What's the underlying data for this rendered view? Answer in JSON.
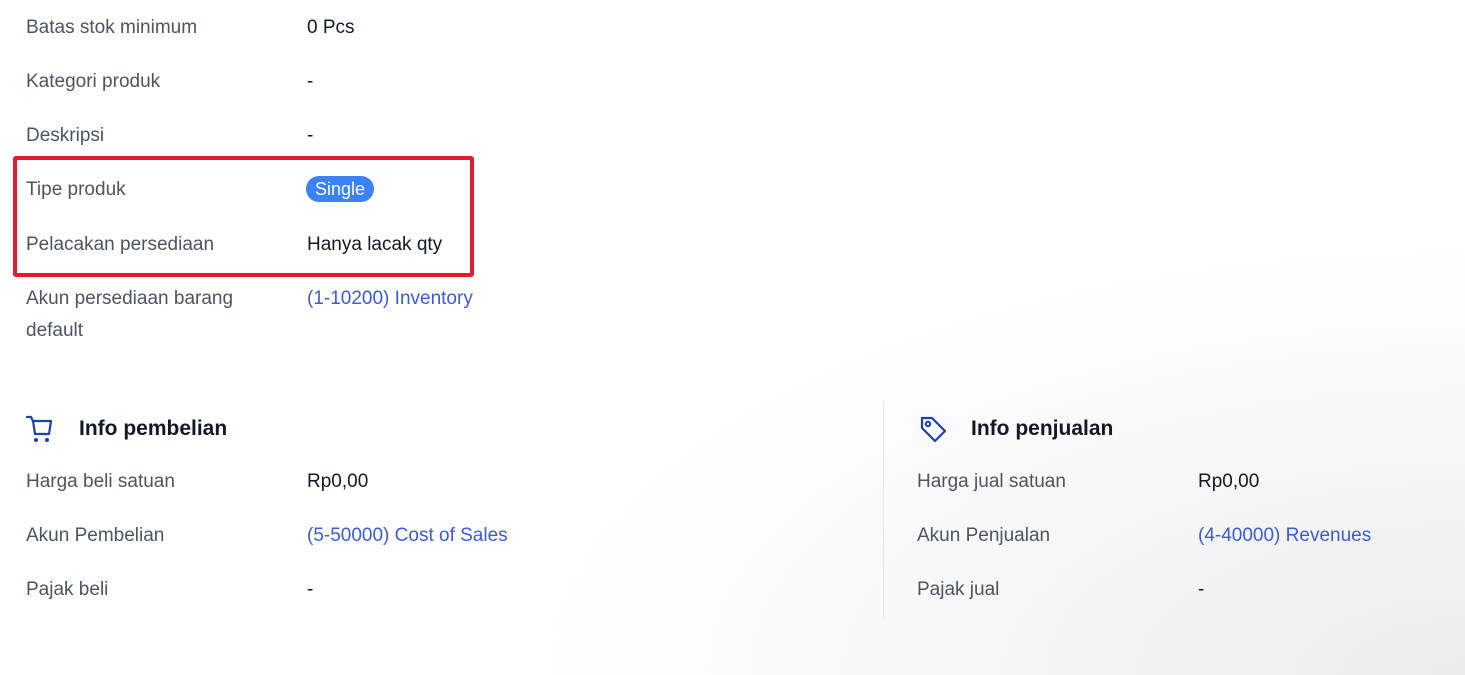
{
  "details": {
    "min_stock": {
      "label": "Batas stok minimum",
      "value": "0 Pcs"
    },
    "category": {
      "label": "Kategori produk",
      "value": "-"
    },
    "description": {
      "label": "Deskripsi",
      "value": "-"
    },
    "product_type": {
      "label": "Tipe produk",
      "value": "Single"
    },
    "inventory_tracking": {
      "label": "Pelacakan persediaan",
      "value": "Hanya lacak qty"
    },
    "default_inventory_account": {
      "label_line1": "Akun persediaan barang",
      "label_line2": "default",
      "value": "(1-10200) Inventory"
    }
  },
  "purchase": {
    "title": "Info pembelian",
    "icon": "shopping-cart-icon",
    "unit_price": {
      "label": "Harga beli satuan",
      "value": "Rp0,00"
    },
    "account": {
      "label": "Akun Pembelian",
      "value": "(5-50000) Cost of Sales"
    },
    "tax": {
      "label": "Pajak beli",
      "value": "-"
    }
  },
  "sales": {
    "title": "Info penjualan",
    "icon": "price-tag-icon",
    "unit_price": {
      "label": "Harga jual satuan",
      "value": "Rp0,00"
    },
    "account": {
      "label": "Akun Penjualan",
      "value": "(4-40000) Revenues"
    },
    "tax": {
      "label": "Pajak jual",
      "value": "-"
    }
  },
  "colors": {
    "link": "#3b5bdb",
    "badge": "#3b82f6",
    "highlight_border": "#e11d2a",
    "icon": "#1e40af"
  }
}
